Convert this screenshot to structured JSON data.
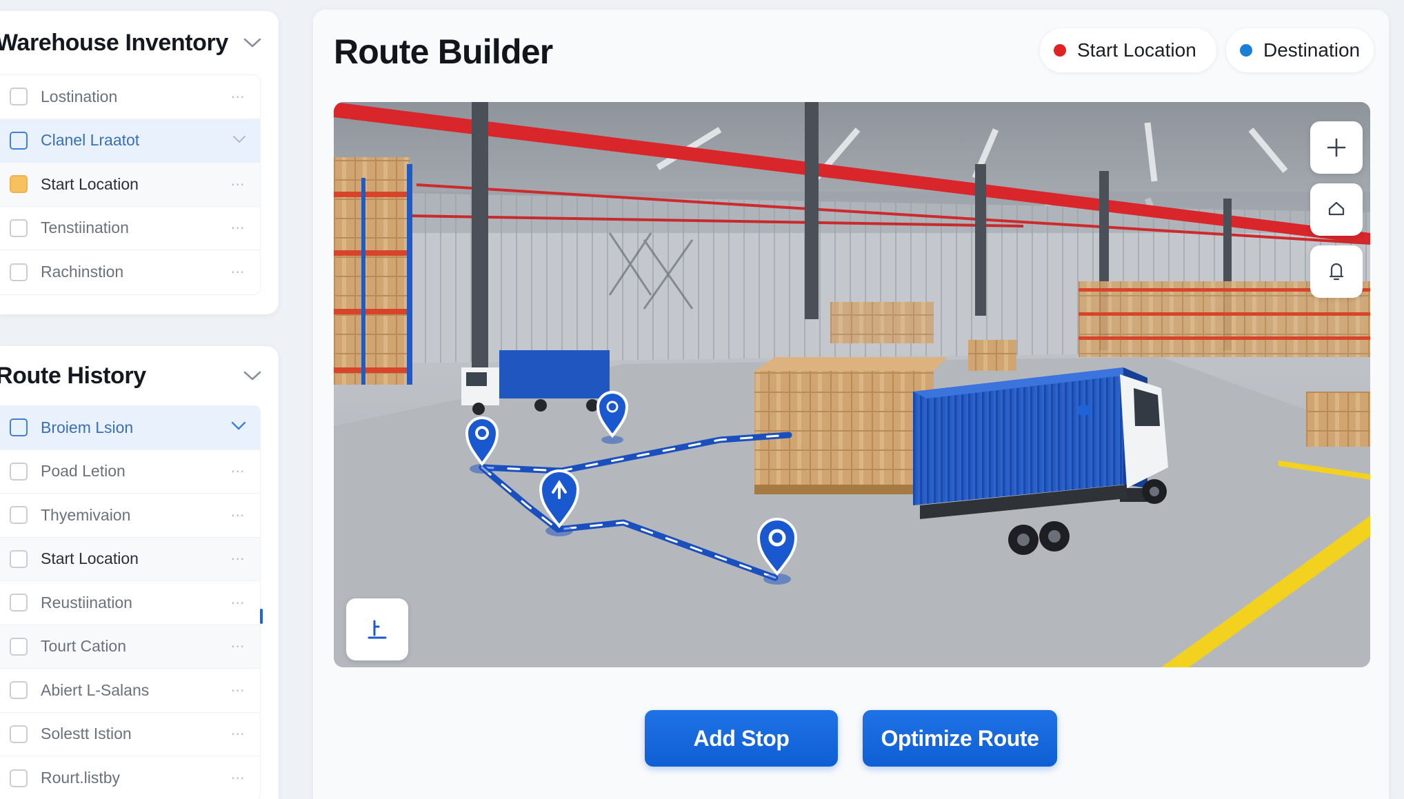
{
  "sidebar": {
    "inventory": {
      "title": "Warehouse Inventory",
      "items": [
        {
          "label": "Lostination"
        },
        {
          "label": "Clanel Lraatot"
        },
        {
          "label": "Start Location"
        },
        {
          "label": "Tenstiination"
        },
        {
          "label": "Rachinstion"
        }
      ]
    },
    "history": {
      "title": "Route History",
      "items": [
        {
          "label": "Broiem Lsion"
        },
        {
          "label": "Poad Letion"
        },
        {
          "label": "Thyemivaion"
        },
        {
          "label": "Start Location"
        },
        {
          "label": "Reustiination"
        },
        {
          "label": "Tourt Cation"
        },
        {
          "label": "Abiert L-Salans"
        },
        {
          "label": "Solestt Istion"
        },
        {
          "label": "Rourt.listby"
        }
      ]
    }
  },
  "main": {
    "title": "Route Builder",
    "legend": {
      "start_label": "Start Location",
      "destination_label": "Destination",
      "start_color": "#e02424",
      "destination_color": "#1a7fd6"
    },
    "map_controls": [
      "plus-icon",
      "home-icon",
      "pin-icon",
      "compass-icon"
    ],
    "actions": {
      "add_stop": "Add Stop",
      "optimize_route": "Optimize Route"
    }
  },
  "colors": {
    "accent": "#1468dc",
    "route": "#1852c4",
    "container": "#1f56c0",
    "beam": "#d8262a"
  }
}
